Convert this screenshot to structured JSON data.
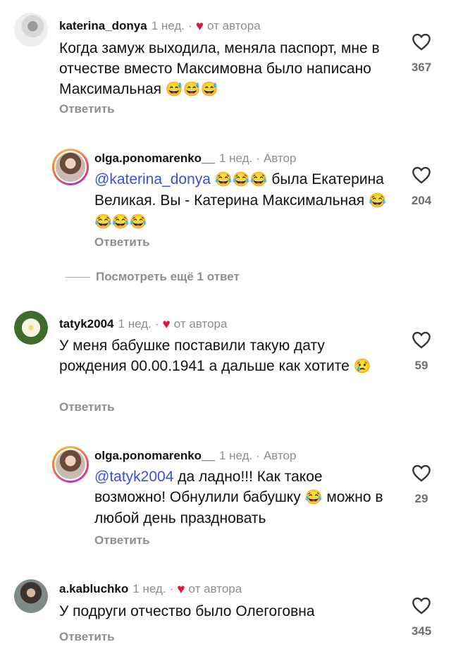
{
  "comments": [
    {
      "username": "katerina_donya",
      "time": "1 нед.",
      "dot": "·",
      "author_liked": "от автора",
      "text": "Когда замуж выходила, меняла паспорт, мне в отчестве вместо Максимовна было написано Максимальная",
      "emojis": "😅😅😅",
      "reply_label": "Ответить",
      "likes": "367",
      "avatar_icon": "profile-photo-icon"
    },
    {
      "username": "olga.ponomarenko__",
      "time": "1 нед.",
      "dot": "·",
      "author_tag": "Автор",
      "mention": "@katerina_donya",
      "emojis_a": "😂😂😂",
      "text_a": " была Екатерина Великая. Вы - Катерина Максимальная ",
      "emojis_b": "😂😂😂😂",
      "reply_label": "Ответить",
      "likes": "204",
      "avatar_icon": "story-ring-avatar-icon"
    },
    {
      "username": "tatyk2004",
      "time": "1 нед.",
      "dot": "·",
      "author_liked": "от автора",
      "text": "У меня бабушке поставили такую дату рождения 00.00.1941 а дальше как хотите",
      "emojis": "😢",
      "reply_label": "Ответить",
      "likes": "59",
      "avatar_icon": "flower-photo-icon"
    },
    {
      "username": "olga.ponomarenko__",
      "time": "1 нед.",
      "dot": "·",
      "author_tag": "Автор",
      "mention": "@tatyk2004",
      "text_a": " да ладно!!! Как такое возможно! Обнулили бабушку ",
      "emojis_a": "😂",
      "text_b": " можно в любой день праздновать",
      "reply_label": "Ответить",
      "likes": "29",
      "avatar_icon": "story-ring-avatar-icon"
    },
    {
      "username": "a.kabluchko",
      "time": "1 нед.",
      "dot": "·",
      "author_liked": "от автора",
      "text": "У подруги отчество было Олегоговна",
      "reply_label": "Ответить",
      "likes": "345",
      "avatar_icon": "profile-photo-icon"
    }
  ],
  "view_more": "Посмотреть ещё 1 ответ",
  "colors": {
    "accent_link": "#3b4fd8",
    "heart_red": "#e0153a",
    "muted": "#8e8e8e"
  }
}
